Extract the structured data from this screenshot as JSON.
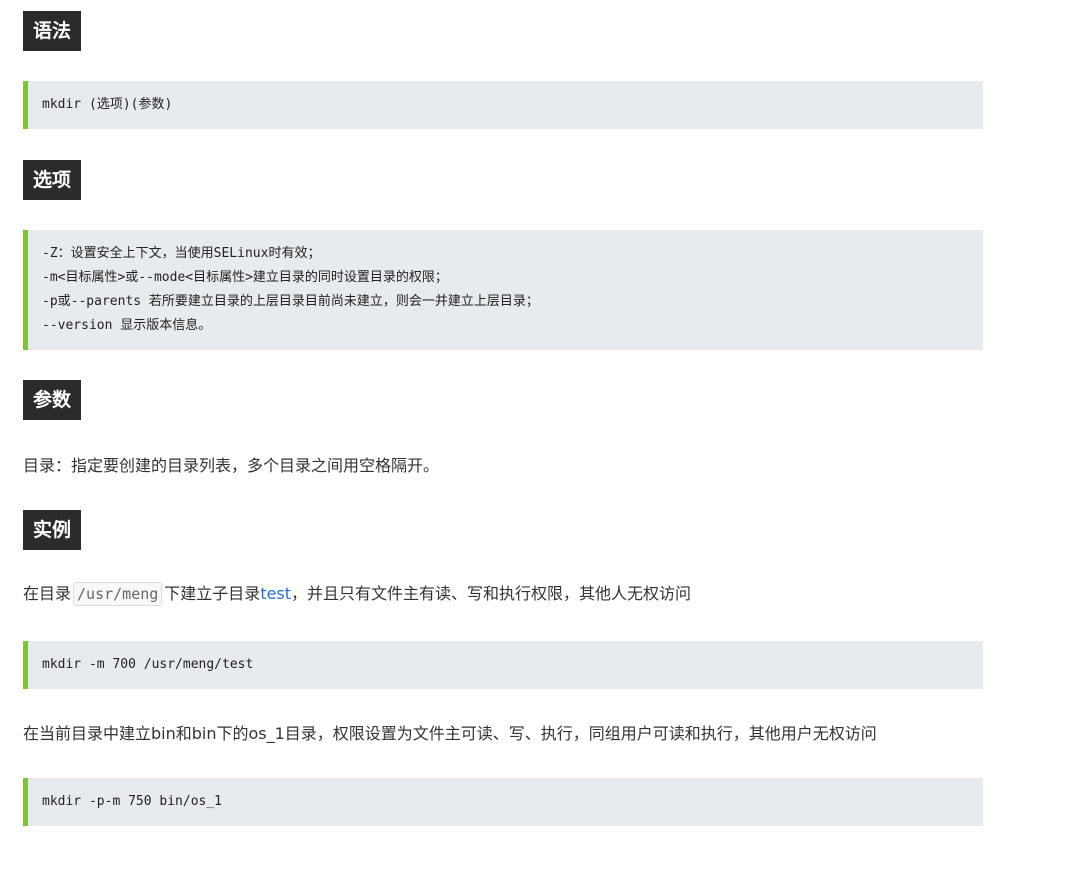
{
  "sections": {
    "syntax": {
      "title": "语法",
      "code": [
        "mkdir (选项)(参数)"
      ]
    },
    "options": {
      "title": "选项",
      "code": [
        "-Z：设置安全上下文，当使用SELinux时有效；",
        "-m<目标属性>或--mode<目标属性>建立目录的同时设置目录的权限；",
        "-p或--parents 若所要建立目录的上层目录目前尚未建立，则会一并建立上层目录；",
        "--version 显示版本信息。"
      ]
    },
    "params": {
      "title": "参数",
      "text": "目录：指定要创建的目录列表，多个目录之间用空格隔开。"
    },
    "examples": {
      "title": "实例",
      "example1": {
        "text_before": "在目录",
        "inline_code": "/usr/meng",
        "text_middle": "下建立子目录",
        "link": "test",
        "text_after": "，并且只有文件主有读、写和执行权限，其他人无权访问",
        "code": [
          "mkdir -m 700 /usr/meng/test"
        ]
      },
      "example2": {
        "text": "在当前目录中建立bin和bin下的os_1目录，权限设置为文件主可读、写、执行，同组用户可读和执行，其他用户无权访问",
        "code": [
          "mkdir -p-m 750 bin/os_1"
        ]
      }
    }
  },
  "colors": {
    "heading_bg": "#2b2b2b",
    "code_bg": "#e7eaee",
    "code_border": "#7cc53a",
    "link": "#2a6bd0"
  }
}
